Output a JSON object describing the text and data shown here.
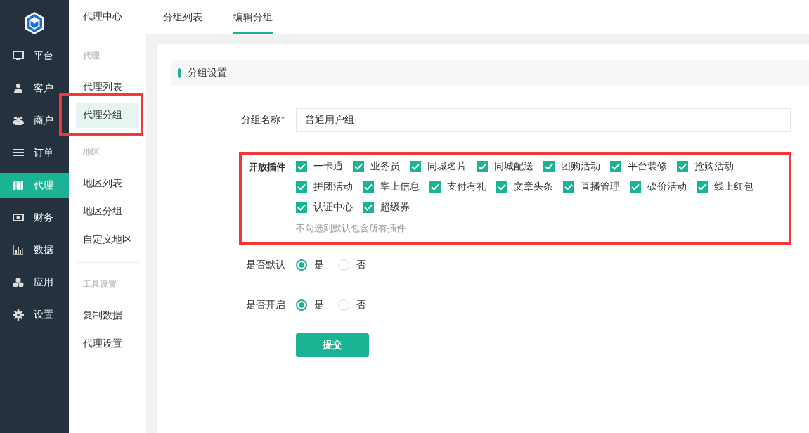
{
  "sidebar": {
    "items": [
      {
        "label": "平台",
        "selected": false
      },
      {
        "label": "客户",
        "selected": false
      },
      {
        "label": "商户",
        "selected": false
      },
      {
        "label": "订单",
        "selected": false
      },
      {
        "label": "代理",
        "selected": true
      },
      {
        "label": "财务",
        "selected": false
      },
      {
        "label": "数据",
        "selected": false
      },
      {
        "label": "应用",
        "selected": false
      },
      {
        "label": "设置",
        "selected": false
      }
    ]
  },
  "subnav": {
    "title": "代理中心",
    "groups": [
      {
        "heading": "代理",
        "divider_before": false,
        "items": [
          {
            "label": "代理列表",
            "selected": false,
            "highlighted": false
          },
          {
            "label": "代理分组",
            "selected": true,
            "highlighted": true
          }
        ]
      },
      {
        "heading": "地区",
        "divider_before": false,
        "items": [
          {
            "label": "地区列表",
            "selected": false,
            "highlighted": false
          },
          {
            "label": "地区分组",
            "selected": false,
            "highlighted": false
          },
          {
            "label": "自定义地区",
            "selected": false,
            "highlighted": false
          }
        ]
      },
      {
        "heading": "工具设置",
        "divider_before": true,
        "items": [
          {
            "label": "复制数据",
            "selected": false,
            "highlighted": false
          },
          {
            "label": "代理设置",
            "selected": false,
            "highlighted": false
          }
        ]
      }
    ]
  },
  "tabs": [
    {
      "label": "分组列表",
      "selected": false
    },
    {
      "label": "编辑分组",
      "selected": true
    }
  ],
  "section": {
    "title": "分组设置"
  },
  "form": {
    "name_field": {
      "label": "分组名称",
      "required_mark": "*",
      "value": "普通用户组"
    },
    "plugins": {
      "label": "开放插件",
      "highlighted": true,
      "hint": "不勾选则默认包含所有插件",
      "options": [
        {
          "label": "一卡通",
          "checked": true
        },
        {
          "label": "业务员",
          "checked": true
        },
        {
          "label": "同城名片",
          "checked": true
        },
        {
          "label": "同城配送",
          "checked": true
        },
        {
          "label": "团购活动",
          "checked": true
        },
        {
          "label": "平台装修",
          "checked": true
        },
        {
          "label": "抢购活动",
          "checked": true
        },
        {
          "label": "拼团活动",
          "checked": true
        },
        {
          "label": "掌上信息",
          "checked": true
        },
        {
          "label": "支付有礼",
          "checked": true
        },
        {
          "label": "文章头条",
          "checked": true
        },
        {
          "label": "直播管理",
          "checked": true
        },
        {
          "label": "砍价活动",
          "checked": true
        },
        {
          "label": "线上红包",
          "checked": true
        },
        {
          "label": "认证中心",
          "checked": true
        },
        {
          "label": "超级券",
          "checked": true
        }
      ]
    },
    "radio_groups": [
      {
        "label": "是否默认",
        "options": [
          {
            "label": "是",
            "selected": true
          },
          {
            "label": "否",
            "selected": false
          }
        ]
      },
      {
        "label": "是否开启",
        "options": [
          {
            "label": "是",
            "selected": true
          },
          {
            "label": "否",
            "selected": false
          }
        ]
      }
    ],
    "submit": "提交"
  }
}
